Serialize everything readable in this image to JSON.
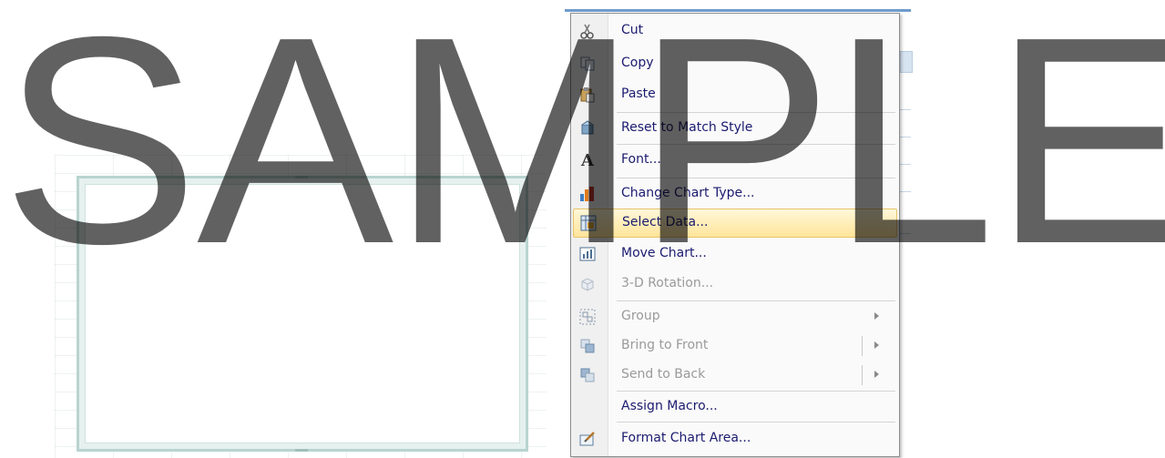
{
  "menu": {
    "items": [
      {
        "label": "Cut",
        "icon": "scissors-icon",
        "disabled": false
      },
      {
        "label": "Copy",
        "icon": "copy-icon",
        "disabled": false
      },
      {
        "label": "Paste",
        "icon": "paste-icon",
        "disabled": false
      },
      {
        "label": "Reset to Match Style",
        "icon": "reset-style-icon",
        "disabled": false
      },
      {
        "label": "Font...",
        "icon": "font-icon",
        "disabled": false
      },
      {
        "label": "Change Chart Type...",
        "icon": "chart-type-icon",
        "disabled": false
      },
      {
        "label": "Select Data...",
        "icon": "select-data-icon",
        "disabled": false,
        "highlighted": true
      },
      {
        "label": "Move Chart...",
        "icon": "move-chart-icon",
        "disabled": false
      },
      {
        "label": "3-D Rotation...",
        "icon": "rotation-icon",
        "disabled": true
      },
      {
        "label": "Group",
        "icon": "group-icon",
        "disabled": true,
        "submenu": true
      },
      {
        "label": "Bring to Front",
        "icon": "bring-front-icon",
        "disabled": true,
        "submenu": true
      },
      {
        "label": "Send to Back",
        "icon": "send-back-icon",
        "disabled": true,
        "submenu": true
      },
      {
        "label": "Assign Macro...",
        "icon": "",
        "disabled": false
      },
      {
        "label": "Format Chart Area...",
        "icon": "format-icon",
        "disabled": false
      }
    ]
  },
  "watermark": {
    "text": "SAMPLE"
  },
  "colors": {
    "highlight": "#ffe59a",
    "menu_text": "#1b1b70",
    "disabled_text": "#9a9a9a"
  }
}
